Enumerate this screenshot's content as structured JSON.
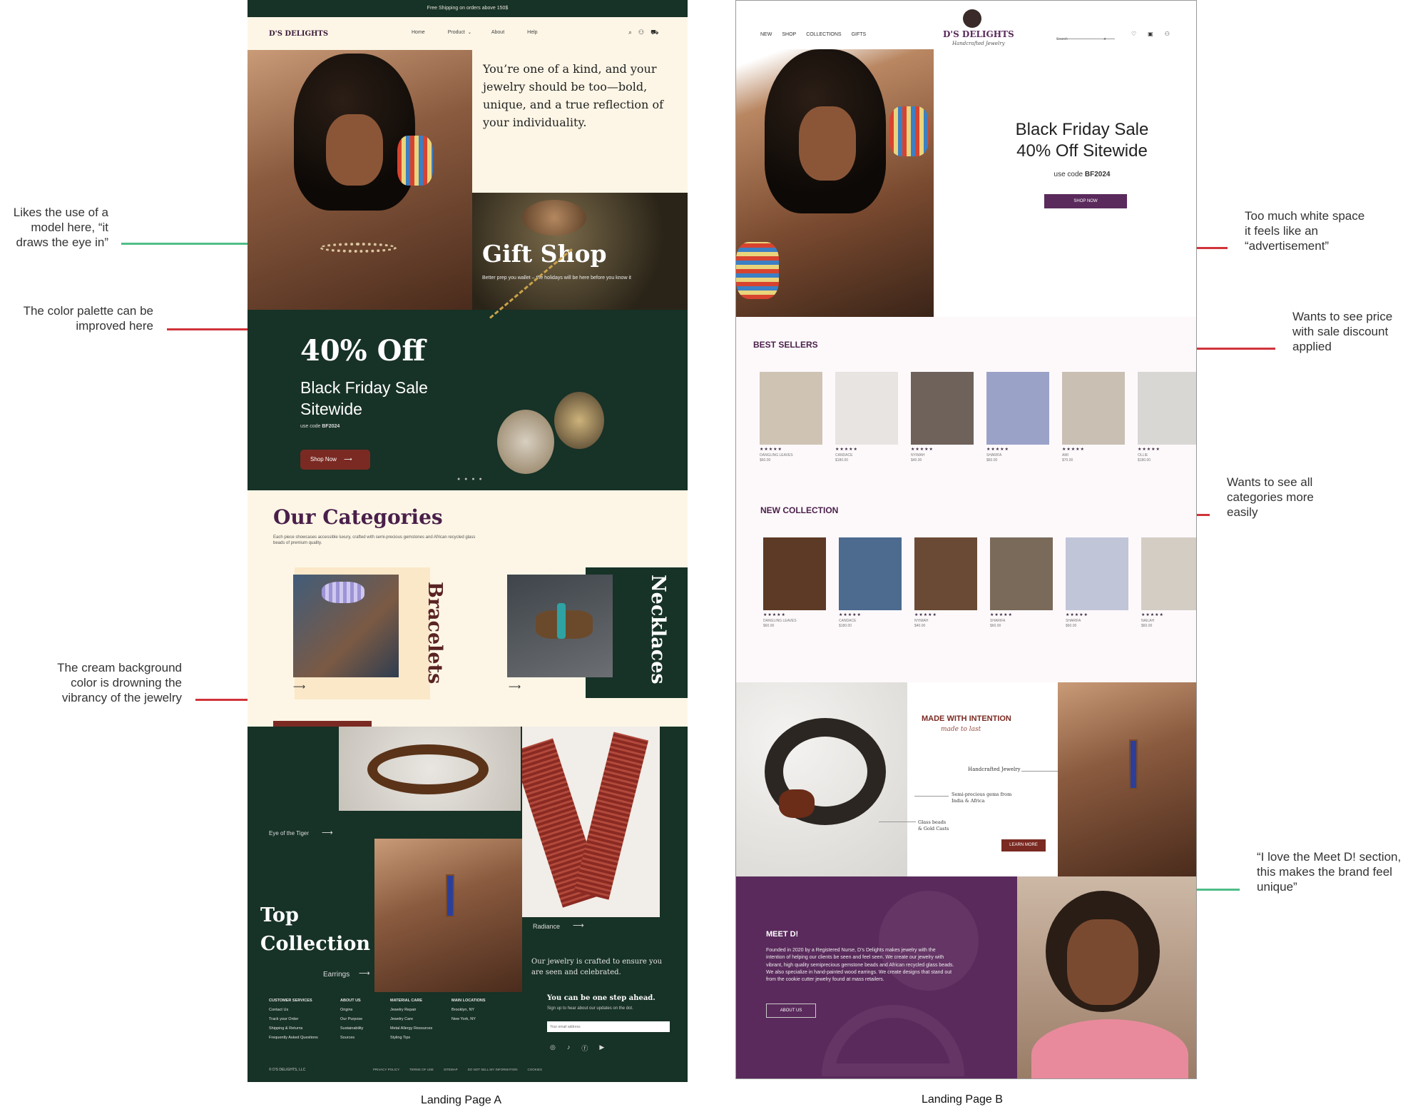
{
  "annotations": [
    {
      "text": "Likes the use of a model here, “it draws the eye in”"
    },
    {
      "text": "The color palette can be improved here"
    },
    {
      "text": "The cream background color is drowning the vibrancy of the jewelry"
    },
    {
      "text": "Too much white space it feels like an “advertisement”"
    },
    {
      "text": "Wants to see price with sale discount applied"
    },
    {
      "text": "Wants to see all categories more easily"
    },
    {
      "text": "“I love the Meet D! section, this makes the brand feel unique”"
    }
  ],
  "captions": {
    "a": "Landing Page A",
    "b": "Landing Page B"
  },
  "pageA": {
    "promo_bar": "Free Shipping on orders above 150$",
    "logo": "D'S DELIGHTS",
    "nav": [
      "Home",
      "Product",
      "About",
      "Help"
    ],
    "hero_text": "You’re one of a kind, and your jewelry should be too—bold, unique, and a true reflection of your individuality.",
    "gift_title": "Gift Shop",
    "gift_sub": "Better prep you wallet – the holidays will be here before you know it",
    "sale_headline": "40% Off",
    "sale_title_1": "Black Friday Sale",
    "sale_title_2": "Sitewide",
    "sale_code_prefix": "use code ",
    "sale_code": "BF2024",
    "shop_now": "Shop Now",
    "categories_title": "Our Categories",
    "categories_desc": "Each piece showcases accessible luxury, crafted with semi-precious gemstones and African recycled glass beads of premium quality.",
    "cat_bracelets": "Bracelets",
    "cat_necklaces": "Necklaces",
    "top_collection_1": "Top",
    "top_collection_2": "Collection",
    "col_eye_tiger": "Eye of the Tiger",
    "col_radiance": "Radiance",
    "col_earrings": "Earrings",
    "col_statement": "Our jewelry is crafted to ensure you are seen and celebrated.",
    "footer_cols": [
      {
        "title": "CUSTOMER SERVICES",
        "items": [
          "Contact Us",
          "Track your Order",
          "Shipping & Returns",
          "Frequently Asked Questions"
        ]
      },
      {
        "title": "ABOUT US",
        "items": [
          "Origins",
          "Our Purpose",
          "Sustainability",
          "Sources"
        ]
      },
      {
        "title": "MATERIAL CARE",
        "items": [
          "Jewelry Repair",
          "Jewelry Care",
          "Metal Allergy Resources",
          "Styling Tips"
        ]
      },
      {
        "title": "MAIN LOCATIONS",
        "items": [
          "Brooklyn, NY",
          "New York, NY"
        ]
      }
    ],
    "newsletter_title": "You can be one step ahead.",
    "newsletter_sub": "Sign up to hear about our updates on the dot.",
    "email_placeholder": "Your email address",
    "copyright": "© D'S DELIGHTS, LLC",
    "legal": [
      "PRIVACY POLICY",
      "TERMS OF USE",
      "SITEMAP",
      "DO NOT SELL MY INFORMATION",
      "COOKIES"
    ]
  },
  "pageB": {
    "nav": [
      "NEW",
      "SHOP",
      "COLLECTIONS",
      "GIFTS"
    ],
    "logo": "D'S DELIGHTS",
    "logo_sub": "Handcrafted Jewelry",
    "search_placeholder": "Search",
    "hero_title_1": "Black Friday Sale",
    "hero_title_2": "40% Off Sitewide",
    "hero_code_prefix": "use code ",
    "hero_code": "BF2024",
    "hero_button": "SHOP NOW",
    "best_sellers_title": "BEST SELLERS",
    "best_sellers": [
      {
        "name": "DANGLING LEAVES",
        "price": "$60.00",
        "stars": "★★★★★"
      },
      {
        "name": "CANDACE",
        "price": "$180.00",
        "stars": "★★★★★"
      },
      {
        "name": "NYIMAH",
        "price": "$40.00",
        "stars": "★★★★★"
      },
      {
        "name": "SHARIFA",
        "price": "$60.00",
        "stars": "★★★★★"
      },
      {
        "name": "AMI",
        "price": "$70.00",
        "stars": "★★★★★"
      },
      {
        "name": "OLLIE",
        "price": "$180.00",
        "stars": "★★★★★"
      }
    ],
    "new_collection_title": "NEW COLLECTION",
    "new_collection": [
      {
        "name": "DANGLING LEAVES",
        "price": "$60.00",
        "stars": "★★★★★"
      },
      {
        "name": "CANDACE",
        "price": "$180.00",
        "stars": "★★★★★"
      },
      {
        "name": "NYIMAH",
        "price": "$40.00",
        "stars": "★★★★★"
      },
      {
        "name": "SHARIFA",
        "price": "$60.00",
        "stars": "★★★★★"
      },
      {
        "name": "SHARIFA",
        "price": "$60.00",
        "stars": "★★★★★"
      },
      {
        "name": "NAILAH",
        "price": "$60.00",
        "stars": "★★★★★"
      }
    ],
    "made_title": "MADE WITH INTENTION",
    "made_sub": "made to last",
    "callout_1": "Handcrafted Jewelry",
    "callout_2a": "Semi-precious gems from",
    "callout_2b": "India & Africa",
    "callout_3a": "Glass beads",
    "callout_3b": "& Gold Casts",
    "learn_more": "LEARN MORE",
    "meet_title": "MEET D!",
    "meet_body": "Founded in 2020 by a Registered Nurse, D’s Delights makes jewelry with the intention of helping our clients be seen and feel seen. We create our jewelry with vibrant, high quality semiprecious gemstone beads and African recycled glass beads. We also specialize in hand-painted wood earrings. We create designs that stand out from the cookie cutter jewelry found at mass retailers.",
    "about_us": "ABOUT US"
  }
}
